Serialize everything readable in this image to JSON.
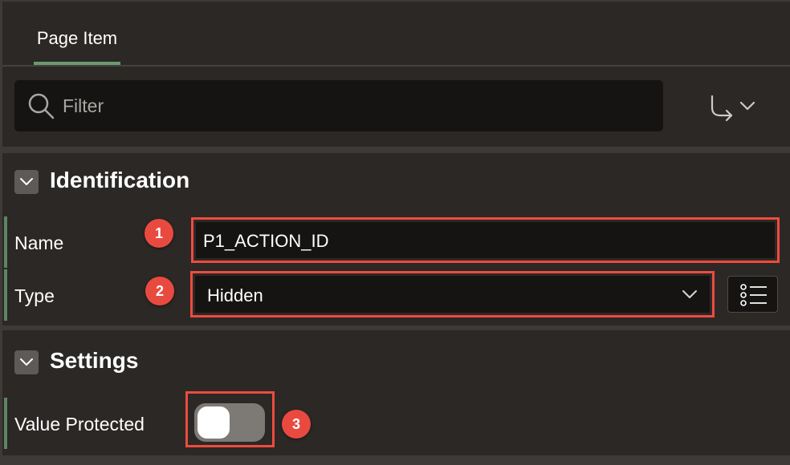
{
  "tabs": [
    {
      "label": "Page Item",
      "active": true
    }
  ],
  "filter": {
    "placeholder": "Filter",
    "value": ""
  },
  "sections": {
    "identification": {
      "title": "Identification",
      "name_label": "Name",
      "name_value": "P1_ACTION_ID",
      "type_label": "Type",
      "type_value": "Hidden"
    },
    "settings": {
      "title": "Settings",
      "value_protected_label": "Value Protected",
      "value_protected_on": false
    }
  },
  "badges": [
    "1",
    "2",
    "3"
  ],
  "colors": {
    "background": "#2b2826",
    "input_bg": "#161413",
    "accent_green": "#6b9a6f",
    "highlight_red": "#ee4b3e",
    "badge_red": "#e94a3f"
  },
  "icons": [
    "search-icon",
    "go-to-group-icon",
    "chevron-down-icon",
    "list-view-icon",
    "collapse-chevron-icon"
  ]
}
